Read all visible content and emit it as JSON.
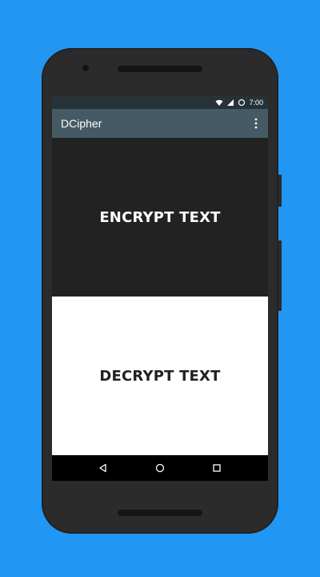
{
  "status": {
    "time": "7:00",
    "icons": [
      "wifi-icon",
      "cell-signal-icon",
      "battery-icon"
    ]
  },
  "toolbar": {
    "title": "DCipher",
    "more_icon": "more-vert-icon"
  },
  "actions": {
    "encrypt_label": "ENCRYPT TEXT",
    "decrypt_label": "DECRYPT TEXT"
  },
  "nav": {
    "back_icon": "back-icon",
    "home_icon": "home-icon",
    "recents_icon": "recents-icon"
  },
  "colors": {
    "background": "#2196F3",
    "status_bar": "#263238",
    "toolbar": "#455A64",
    "encrypt_panel": "#222222",
    "decrypt_panel": "#FFFFFF",
    "nav_bar": "#000000"
  }
}
